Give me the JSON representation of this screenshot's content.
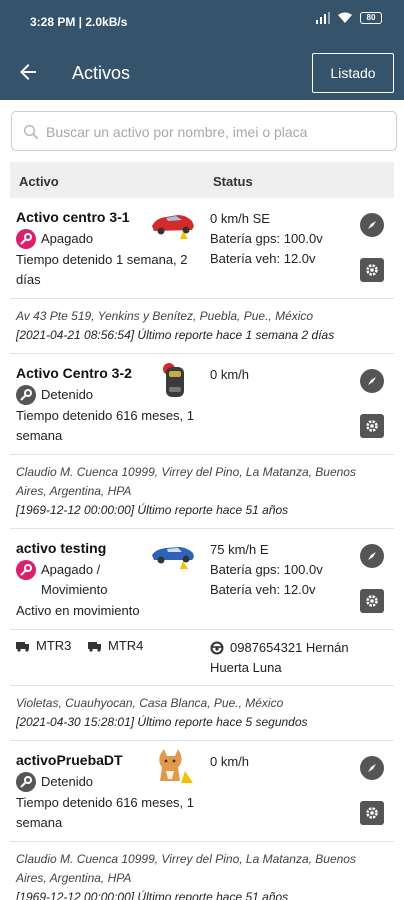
{
  "status_bar": {
    "time_net": "3:28 PM | 2.0kB/s",
    "battery": "80"
  },
  "header": {
    "title": "Activos",
    "listado_label": "Listado"
  },
  "search": {
    "placeholder": "Buscar un activo por nombre, imei o placa"
  },
  "table": {
    "col_activo": "Activo",
    "col_status": "Status"
  },
  "assets": [
    {
      "name": "Activo centro 3-1",
      "state": "Apagado",
      "state_color": "#d9206c",
      "description": "Tiempo detenido 1 semana, 2 días",
      "status": [
        "0 km/h SE",
        "Batería gps: 100.0v",
        "Batería veh: 12.0v"
      ],
      "address": "Av 43 Pte 519, Yenkins y Benítez, Puebla, Pue., México",
      "report": "[2021-04-21 08:56:54] Último reporte hace 1 semana 2 días"
    },
    {
      "name": "Activo Centro 3-2",
      "state": "Detenido",
      "state_color": "#555555",
      "description": "Tiempo detenido 616 meses, 1 semana",
      "status": [
        "0 km/h"
      ],
      "address": "Claudio M. Cuenca 10999, Virrey del Pino, La Matanza, Buenos Aires, Argentina, HPA",
      "report": "[1969-12-12 00:00:00] Último reporte hace 51 años"
    },
    {
      "name": "activo testing",
      "state": "Apagado / Movimiento",
      "state_color": "#d9206c",
      "description": "Activo en movimiento",
      "status": [
        "75 km/h E",
        "Batería gps: 100.0v",
        "Batería veh: 12.0v"
      ],
      "tags": [
        "MTR3",
        "MTR4"
      ],
      "driver": "0987654321 Hernán Huerta Luna",
      "address": "Violetas, Cuauhyocan, Casa Blanca, Pue., México",
      "report": "[2021-04-30 15:28:01] Último reporte hace 5 segundos"
    },
    {
      "name": "activoPruebaDT",
      "state": "Detenido",
      "state_color": "#555555",
      "description": "Tiempo detenido 616 meses, 1 semana",
      "status": [
        "0 km/h"
      ],
      "address": "Claudio M. Cuenca 10999, Virrey del Pino, La Matanza, Buenos Aires, Argentina, HPA",
      "report": "[1969-12-12 00:00:00] Último reporte hace 51 años"
    }
  ]
}
